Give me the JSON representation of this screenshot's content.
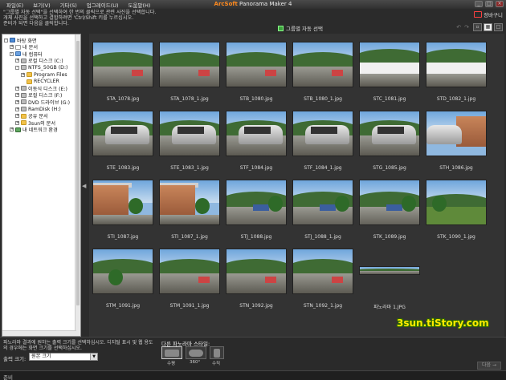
{
  "menu": [
    "파일(E)",
    "보기(V)",
    "기타(S)",
    "업그레이드(U)",
    "도움말(H)"
  ],
  "app_title": {
    "brand": "ArcSoft",
    "name": "Panorama Maker 4"
  },
  "instructions": [
    "\"그룹별 자동 선택\"을 선택하여 한 번의 클릭으로 관련 사진을 선택합니다.",
    "개체 사진을 선택하고 결합하려면 'Ctrl/Shift 키를 누르십시오.",
    "준비가 되면 다음을 클릭합니다."
  ],
  "cart_label": "장바구니",
  "auto_select_label": "그룹별 자동 선택",
  "tree": [
    {
      "label": "바탕 화면",
      "icon": "desktop-icon",
      "level": 0,
      "exp": "-"
    },
    {
      "label": "내 문서",
      "icon": "documents-icon",
      "level": 1,
      "exp": "+"
    },
    {
      "label": "내 컴퓨터",
      "icon": "computer-icon",
      "level": 1,
      "exp": "-"
    },
    {
      "label": "로컬 디스크 (C:)",
      "icon": "drive-icon",
      "level": 2,
      "exp": "+"
    },
    {
      "label": "NTFS_50GB (D:)",
      "icon": "drive-icon",
      "level": 2,
      "exp": "-"
    },
    {
      "label": "Program Files",
      "icon": "folder-icon",
      "level": 3,
      "exp": "+"
    },
    {
      "label": "RECYCLER",
      "icon": "folder-icon",
      "level": 3,
      "exp": ""
    },
    {
      "label": "이동식 디스크 (E:)",
      "icon": "drive-icon",
      "level": 2,
      "exp": "+"
    },
    {
      "label": "로컬 디스크 (F:)",
      "icon": "drive-icon",
      "level": 2,
      "exp": "+"
    },
    {
      "label": "DVD 드라이브 (G:)",
      "icon": "dvd-icon",
      "level": 2,
      "exp": "+"
    },
    {
      "label": "RamDisk (H:)",
      "icon": "drive-icon",
      "level": 2,
      "exp": "+"
    },
    {
      "label": "공유 문서",
      "icon": "folder-icon",
      "level": 2,
      "exp": "+"
    },
    {
      "label": "3sun의 문서",
      "icon": "folder-icon",
      "level": 2,
      "exp": "+"
    },
    {
      "label": "내 네트워크 환경",
      "icon": "network-icon",
      "level": 1,
      "exp": "+"
    }
  ],
  "photos": [
    {
      "name": "STA_1078.jpg",
      "type": "hill"
    },
    {
      "name": "STA_1078_1.jpg",
      "type": "hill"
    },
    {
      "name": "STB_1080.jpg",
      "type": "hill"
    },
    {
      "name": "STB_1080_1.jpg",
      "type": "hill"
    },
    {
      "name": "STC_1081.jpg",
      "type": "greenhouse"
    },
    {
      "name": "STD_1082_1.jpg",
      "type": "greenhouse"
    },
    {
      "name": "STE_1083.jpg",
      "type": "car"
    },
    {
      "name": "STE_1083_1.jpg",
      "type": "car"
    },
    {
      "name": "STF_1084.jpg",
      "type": "car"
    },
    {
      "name": "STF_1084_1.jpg",
      "type": "car"
    },
    {
      "name": "STG_1085.jpg",
      "type": "car"
    },
    {
      "name": "STH_1086.jpg",
      "type": "housecar"
    },
    {
      "name": "STI_1087.jpg",
      "type": "house"
    },
    {
      "name": "STI_1087_1.jpg",
      "type": "house"
    },
    {
      "name": "STJ_1088.jpg",
      "type": "truck"
    },
    {
      "name": "STJ_1088_1.jpg",
      "type": "truck"
    },
    {
      "name": "STK_1089.jpg",
      "type": "truck"
    },
    {
      "name": "STK_1090_1.jpg",
      "type": "field"
    },
    {
      "name": "STM_1091.jpg",
      "type": "tree"
    },
    {
      "name": "STM_1091_1.jpg",
      "type": "hill"
    },
    {
      "name": "STN_1092.jpg",
      "type": "hill"
    },
    {
      "name": "STN_1092_1.jpg",
      "type": "hill"
    },
    {
      "name": "파노라마 1.JPG",
      "type": "pano"
    }
  ],
  "bottom": {
    "instructions": "파노라마 결과에 원하는 출력 크기를 선택하십시오. 디지털 표시 및 웹 용도의 경우에는 화면 크기를 선택하십시오.",
    "size_label": "출력 크기:",
    "size_value": "원본 크기",
    "style_label": "다른 파노라마 스타일:",
    "styles": [
      {
        "label": "수평",
        "active": true
      },
      {
        "label": "360°",
        "active": false
      },
      {
        "label": "수직",
        "active": false
      }
    ],
    "next_label": "다음 →"
  },
  "watermark": "3sun.tiStory.com",
  "status": "준비"
}
